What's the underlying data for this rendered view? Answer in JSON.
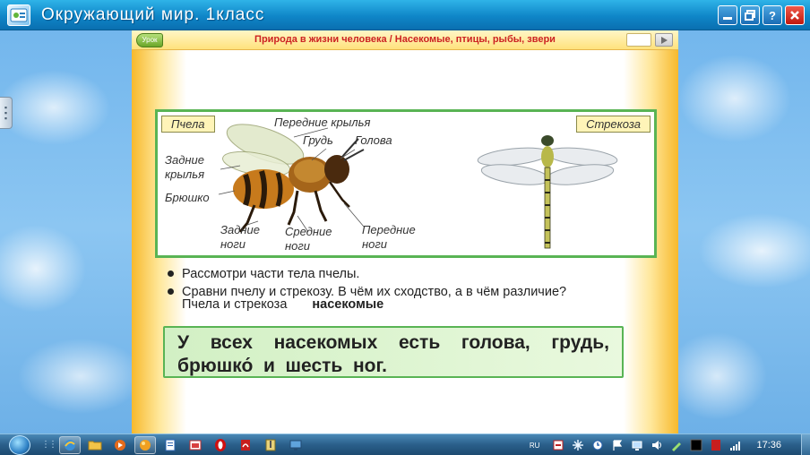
{
  "window": {
    "title": "Окружающий мир. 1класс",
    "buttons": [
      "minimize",
      "restore",
      "help",
      "close"
    ]
  },
  "header": {
    "lesson_button": "Урок",
    "title": "Природа в жизни человека / Насекомые, птицы, рыбы, звери"
  },
  "illustration": {
    "bee_tag": "Пчела",
    "dragonfly_tag": "Стрекоза",
    "labels": {
      "front_wings": "Передние крылья",
      "chest": "Грудь",
      "head": "Голова",
      "hind_wings_1": "Задние",
      "hind_wings_2": "крылья",
      "abdomen": "Брюшко",
      "hind_legs_1": "Задние",
      "hind_legs_2": "ноги",
      "middle_legs_1": "Средние",
      "middle_legs_2": "ноги",
      "front_legs_1": "Передние",
      "front_legs_2": "ноги"
    }
  },
  "tasks": {
    "bullet1": "Рассмотри части тела пчелы.",
    "bullet2": "Сравни пчелу и стрекозу. В чём их сходство, а в чём различие?",
    "answer_prefix": "Пчела и стрекоза",
    "answer_word": "насекомые"
  },
  "rule": {
    "line1_words": [
      "У",
      "всех",
      "насекомых",
      "есть",
      "голова,",
      "грудь,"
    ],
    "line2": "брюшко́  и  шесть  ног."
  },
  "taskbar": {
    "language": "RU",
    "clock": "17:36"
  },
  "colors": {
    "title_bar": "#0f86c8",
    "header_title": "#cc2222",
    "frame_green": "#59b454",
    "panel_orange": "#f7b92c"
  }
}
